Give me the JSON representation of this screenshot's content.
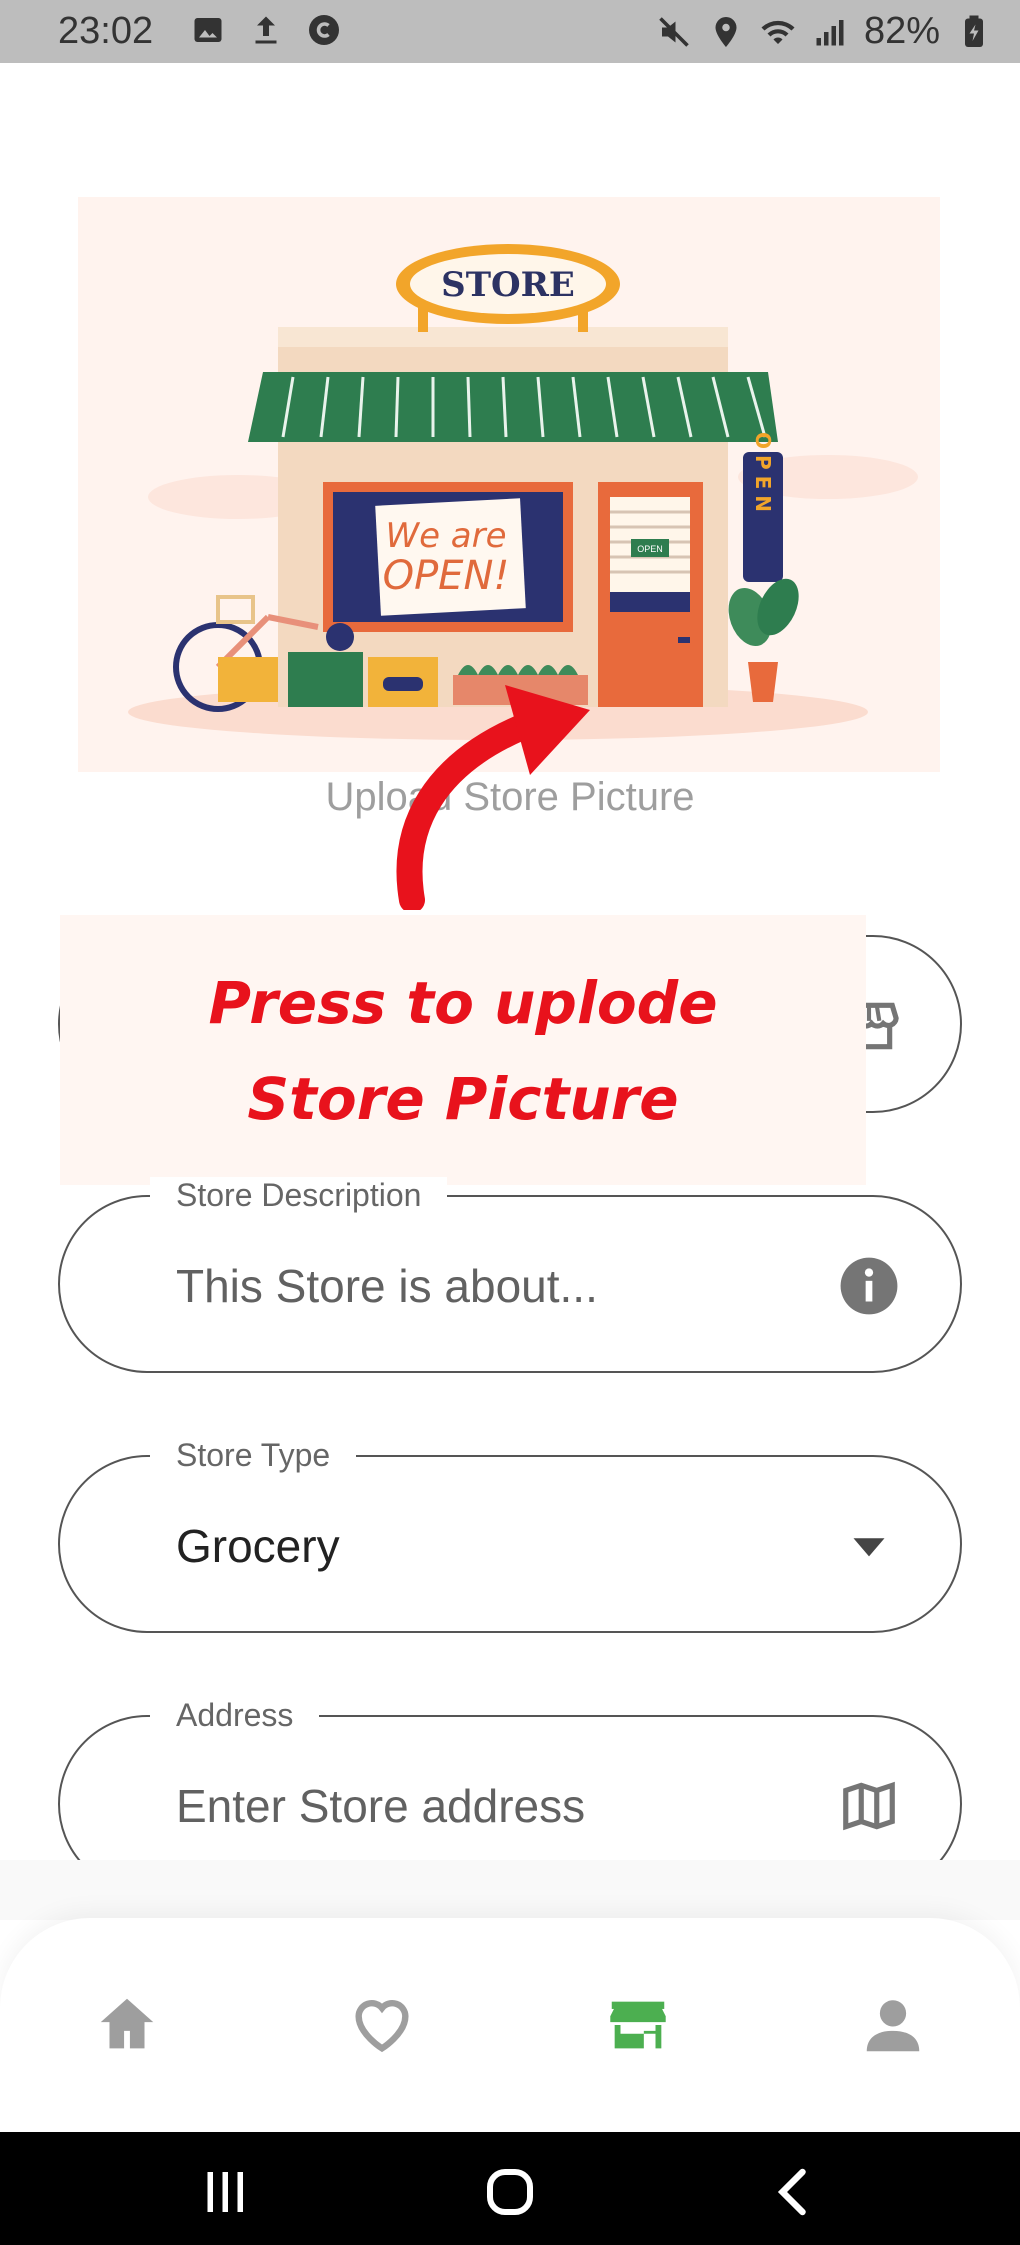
{
  "status": {
    "time": "23:02",
    "battery": "82%"
  },
  "upload": {
    "label": "Upload Store Picture",
    "sign_text": "STORE",
    "poster_line1": "We are",
    "poster_line2": "OPEN!",
    "vertical_sign": "OPEN",
    "door_sign": "OPEN"
  },
  "callout": {
    "line1": "Press to uplode",
    "line2": "Store Picture"
  },
  "form": {
    "store_name_icon": "storefront-icon",
    "description": {
      "label": "Store Description",
      "placeholder": "This Store is about...",
      "icon": "info-icon"
    },
    "type": {
      "label": "Store Type",
      "value": "Grocery",
      "icon": "dropdown-arrow-icon"
    },
    "address": {
      "label": "Address",
      "placeholder": "Enter Store address",
      "icon": "map-icon"
    }
  },
  "nav": {
    "items": [
      "home-icon",
      "favorites-icon",
      "store-icon",
      "profile-icon"
    ],
    "active": "store-icon",
    "active_color": "#4caf50",
    "inactive_color": "#9e9e9e"
  },
  "colors": {
    "callout_text": "#e8121c"
  }
}
